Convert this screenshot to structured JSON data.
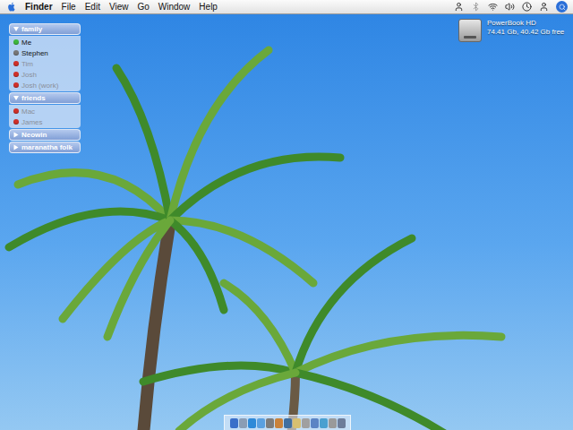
{
  "menu_bar": {
    "app": "Finder",
    "items": [
      "File",
      "Edit",
      "View",
      "Go",
      "Window",
      "Help"
    ]
  },
  "buddy_list": {
    "groups": [
      {
        "name": "family",
        "expanded": true,
        "buddies": [
          {
            "name": "Me",
            "available": true,
            "color": "#3db83d"
          },
          {
            "name": "Stephen",
            "available": true,
            "color": "#777777"
          },
          {
            "name": "Tim",
            "available": false,
            "color": "#d0302a"
          },
          {
            "name": "Josh",
            "available": false,
            "color": "#d0302a"
          },
          {
            "name": "Josh (work)",
            "available": false,
            "color": "#d0302a"
          }
        ]
      },
      {
        "name": "friends",
        "expanded": true,
        "buddies": [
          {
            "name": "Mac",
            "available": false,
            "color": "#d0302a"
          },
          {
            "name": "James",
            "available": false,
            "color": "#d0302a"
          }
        ]
      },
      {
        "name": "Neowin",
        "expanded": false,
        "buddies": []
      },
      {
        "name": "maranatha folk",
        "expanded": false,
        "buddies": []
      }
    ]
  },
  "disk": {
    "name": "PowerBook HD",
    "info": "74.41 Gb, 40.42 Gb free"
  }
}
